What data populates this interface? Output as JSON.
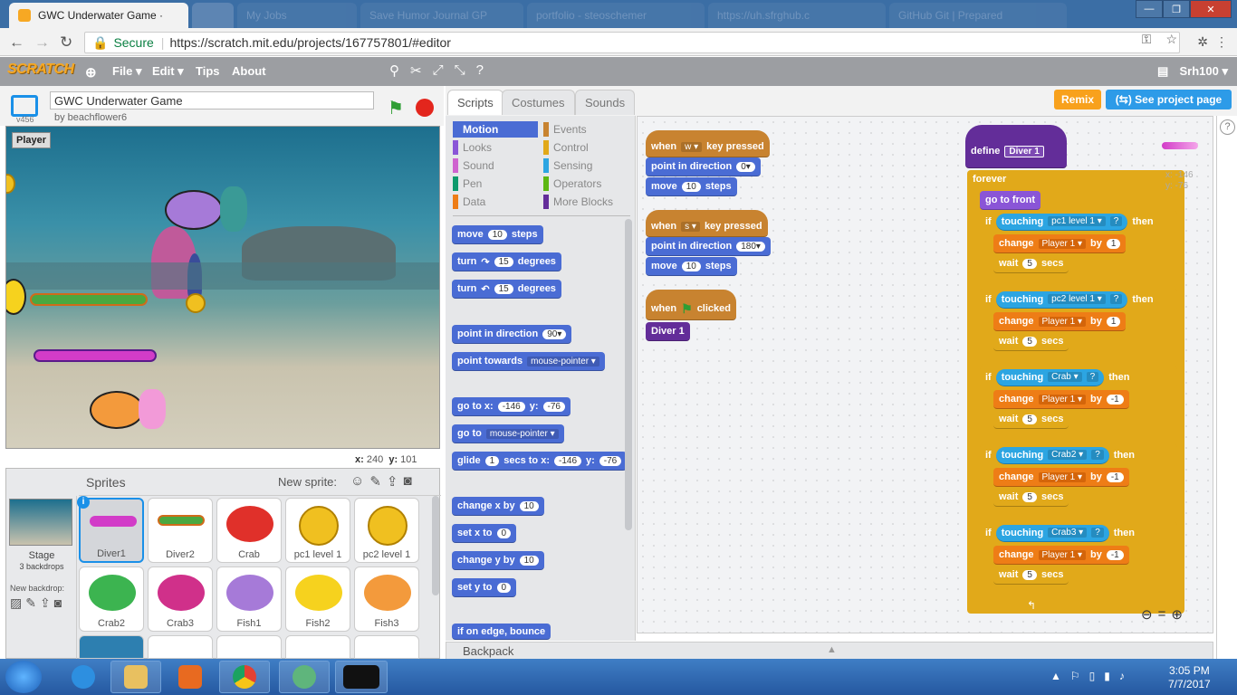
{
  "browser": {
    "active_tab": {
      "title": "GWC Underwater Game ·",
      "close": "✕"
    },
    "inactive_tabs": [
      "My Jobs",
      "Save Humor Journal GP",
      "portfolio - steoschemer",
      "https://uh.sfrghub.c",
      "GitHub Git | Prepared"
    ],
    "window_controls": {
      "minimize": "—",
      "maximize": "❐",
      "close": "✕"
    },
    "secure_label": "Secure",
    "url": "https://scratch.mit.edu/projects/167757801/#editor"
  },
  "scratch_menu": {
    "logo": "SCRATCH",
    "file": "File ▾",
    "edit": "Edit ▾",
    "tips": "Tips",
    "about": "About",
    "user": "Srh100 ▾"
  },
  "project": {
    "version": "v456",
    "title": "GWC Underwater Game",
    "author": "by beachflower6",
    "stage_label": "Player",
    "mouse_x_label": "x:",
    "mouse_x": "240",
    "mouse_y_label": "y:",
    "mouse_y": "101"
  },
  "sprites_panel": {
    "title": "Sprites",
    "new_sprite": "New sprite:",
    "stage_label": "Stage",
    "stage_sub": "3 backdrops",
    "new_backdrop": "New backdrop:",
    "sprites": [
      {
        "name": "Diver1",
        "selected": true
      },
      {
        "name": "Diver2"
      },
      {
        "name": "Crab"
      },
      {
        "name": "pc1 level 1"
      },
      {
        "name": "pc2 level 1"
      },
      {
        "name": "Crab2"
      },
      {
        "name": "Crab3"
      },
      {
        "name": "Fish1"
      },
      {
        "name": "Fish2"
      },
      {
        "name": "Fish3"
      }
    ]
  },
  "editor_tabs": {
    "scripts": "Scripts",
    "costumes": "Costumes",
    "sounds": "Sounds"
  },
  "header_buttons": {
    "remix": "Remix",
    "see_project": "(⇆) See project page"
  },
  "categories": [
    {
      "label": "Motion",
      "color": "#4a6cd4"
    },
    {
      "label": "Events",
      "color": "#c88330"
    },
    {
      "label": "Looks",
      "color": "#8a55d7"
    },
    {
      "label": "Control",
      "color": "#e1a91a"
    },
    {
      "label": "Sound",
      "color": "#cf63cf"
    },
    {
      "label": "Sensing",
      "color": "#2ca5e2"
    },
    {
      "label": "Pen",
      "color": "#0e9a6c"
    },
    {
      "label": "Operators",
      "color": "#5cb712"
    },
    {
      "label": "Data",
      "color": "#ee7d16"
    },
    {
      "label": "More Blocks",
      "color": "#632d99"
    }
  ],
  "palette_blocks": {
    "move": "move",
    "move_n": "10",
    "steps": "steps",
    "turn": "turn",
    "cw": "↷",
    "turn_n1": "15",
    "degrees": "degrees",
    "ccw": "↶",
    "turn_n2": "15",
    "point_dir": "point in direction",
    "point_dir_n": "90▾",
    "point_towards": "point towards",
    "point_towards_v": "mouse-pointer ▾",
    "goto_x": "go to x:",
    "goto_x_n": "-146",
    "goto_y": "y:",
    "goto_y_n": "-76",
    "goto": "go to",
    "goto_v": "mouse-pointer ▾",
    "glide": "glide",
    "glide_n": "1",
    "glide_secs": "secs to x:",
    "glide_x": "-146",
    "glide_y_l": "y:",
    "glide_y": "-76",
    "changex": "change x by",
    "changex_n": "10",
    "setx": "set x to",
    "setx_n": "0",
    "changey": "change y by",
    "changey_n": "10",
    "sety": "set y to",
    "sety_n": "0",
    "bounce": "if on edge, bounce"
  },
  "scripts": {
    "s1_when": "when",
    "s1_key": "w ▾",
    "s1_pressed": "key pressed",
    "s1_point": "point in direction",
    "s1_dir": "0▾",
    "s1_move": "move",
    "s1_n": "10",
    "s1_steps": "steps",
    "s2_when": "when",
    "s2_key": "s ▾",
    "s2_pressed": "key pressed",
    "s2_point": "point in direction",
    "s2_dir": "180▾",
    "s2_move": "move",
    "s2_n": "10",
    "s2_steps": "steps",
    "s3_when": "when",
    "s3_clicked": "clicked",
    "s3_call": "Diver 1",
    "define": "define",
    "define_name": "Diver 1",
    "forever": "forever",
    "gofront": "go to front",
    "if": "if",
    "touching": "touching",
    "then": "then",
    "q": "?",
    "change": "change",
    "by": "by",
    "wait": "wait",
    "secs": "secs",
    "var": "Player 1 ▾",
    "ifs": [
      {
        "target": "pc1 level 1 ▾",
        "by": "1",
        "wait": "5"
      },
      {
        "target": "pc2 level 1 ▾",
        "by": "1",
        "wait": "5"
      },
      {
        "target": "Crab ▾",
        "by": "-1",
        "wait": "5"
      },
      {
        "target": "Crab2 ▾",
        "by": "-1",
        "wait": "5"
      },
      {
        "target": "Crab3 ▾",
        "by": "-1",
        "wait": "5"
      }
    ],
    "loop_arrow": "↰",
    "sprite_x": "x: -146",
    "sprite_y": "y: -76"
  },
  "backpack": "Backpack",
  "taskbar": {
    "time": "3:05 PM",
    "date": "7/7/2017"
  }
}
